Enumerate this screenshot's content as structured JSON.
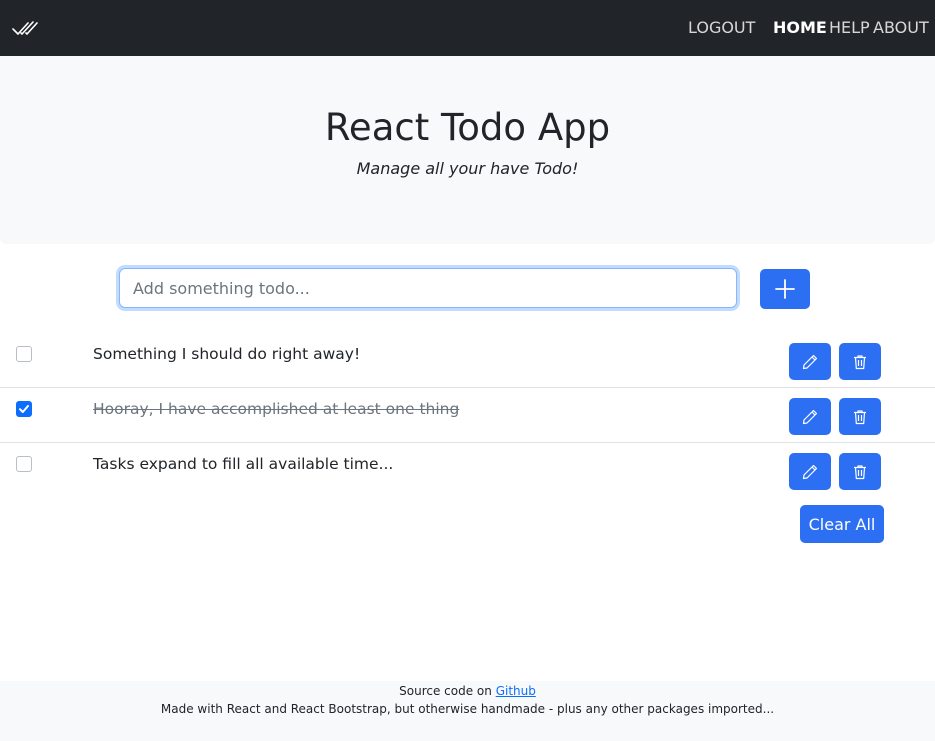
{
  "navbar": {
    "brand_icon": "double-check-icon",
    "logout_label": "LOGOUT",
    "links": [
      {
        "label": "HOME",
        "active": true
      },
      {
        "label": "HELP",
        "active": false
      },
      {
        "label": "ABOUT",
        "active": false
      }
    ]
  },
  "hero": {
    "title": "React Todo App",
    "subtitle": "Manage all your have Todo!"
  },
  "add_form": {
    "placeholder": "Add something todo...",
    "value": "",
    "add_icon": "plus-icon"
  },
  "todos": [
    {
      "text": "Something I should do right away!",
      "completed": false
    },
    {
      "text": "Hooray, I have accomplished at least one thing",
      "completed": true
    },
    {
      "text": "Tasks expand to fill all available time...",
      "completed": false
    }
  ],
  "actions": {
    "edit_icon": "pencil-icon",
    "delete_icon": "trash-icon",
    "clear_all_label": "Clear All"
  },
  "footer": {
    "line1_prefix": "Source code on ",
    "line1_link": "Github",
    "line2": "Made with React and React Bootstrap, but otherwise handmade - plus any other packages imported..."
  },
  "colors": {
    "navbar_bg": "#212529",
    "accent": "#2d6ff2",
    "hero_bg": "#f8f9fa"
  }
}
